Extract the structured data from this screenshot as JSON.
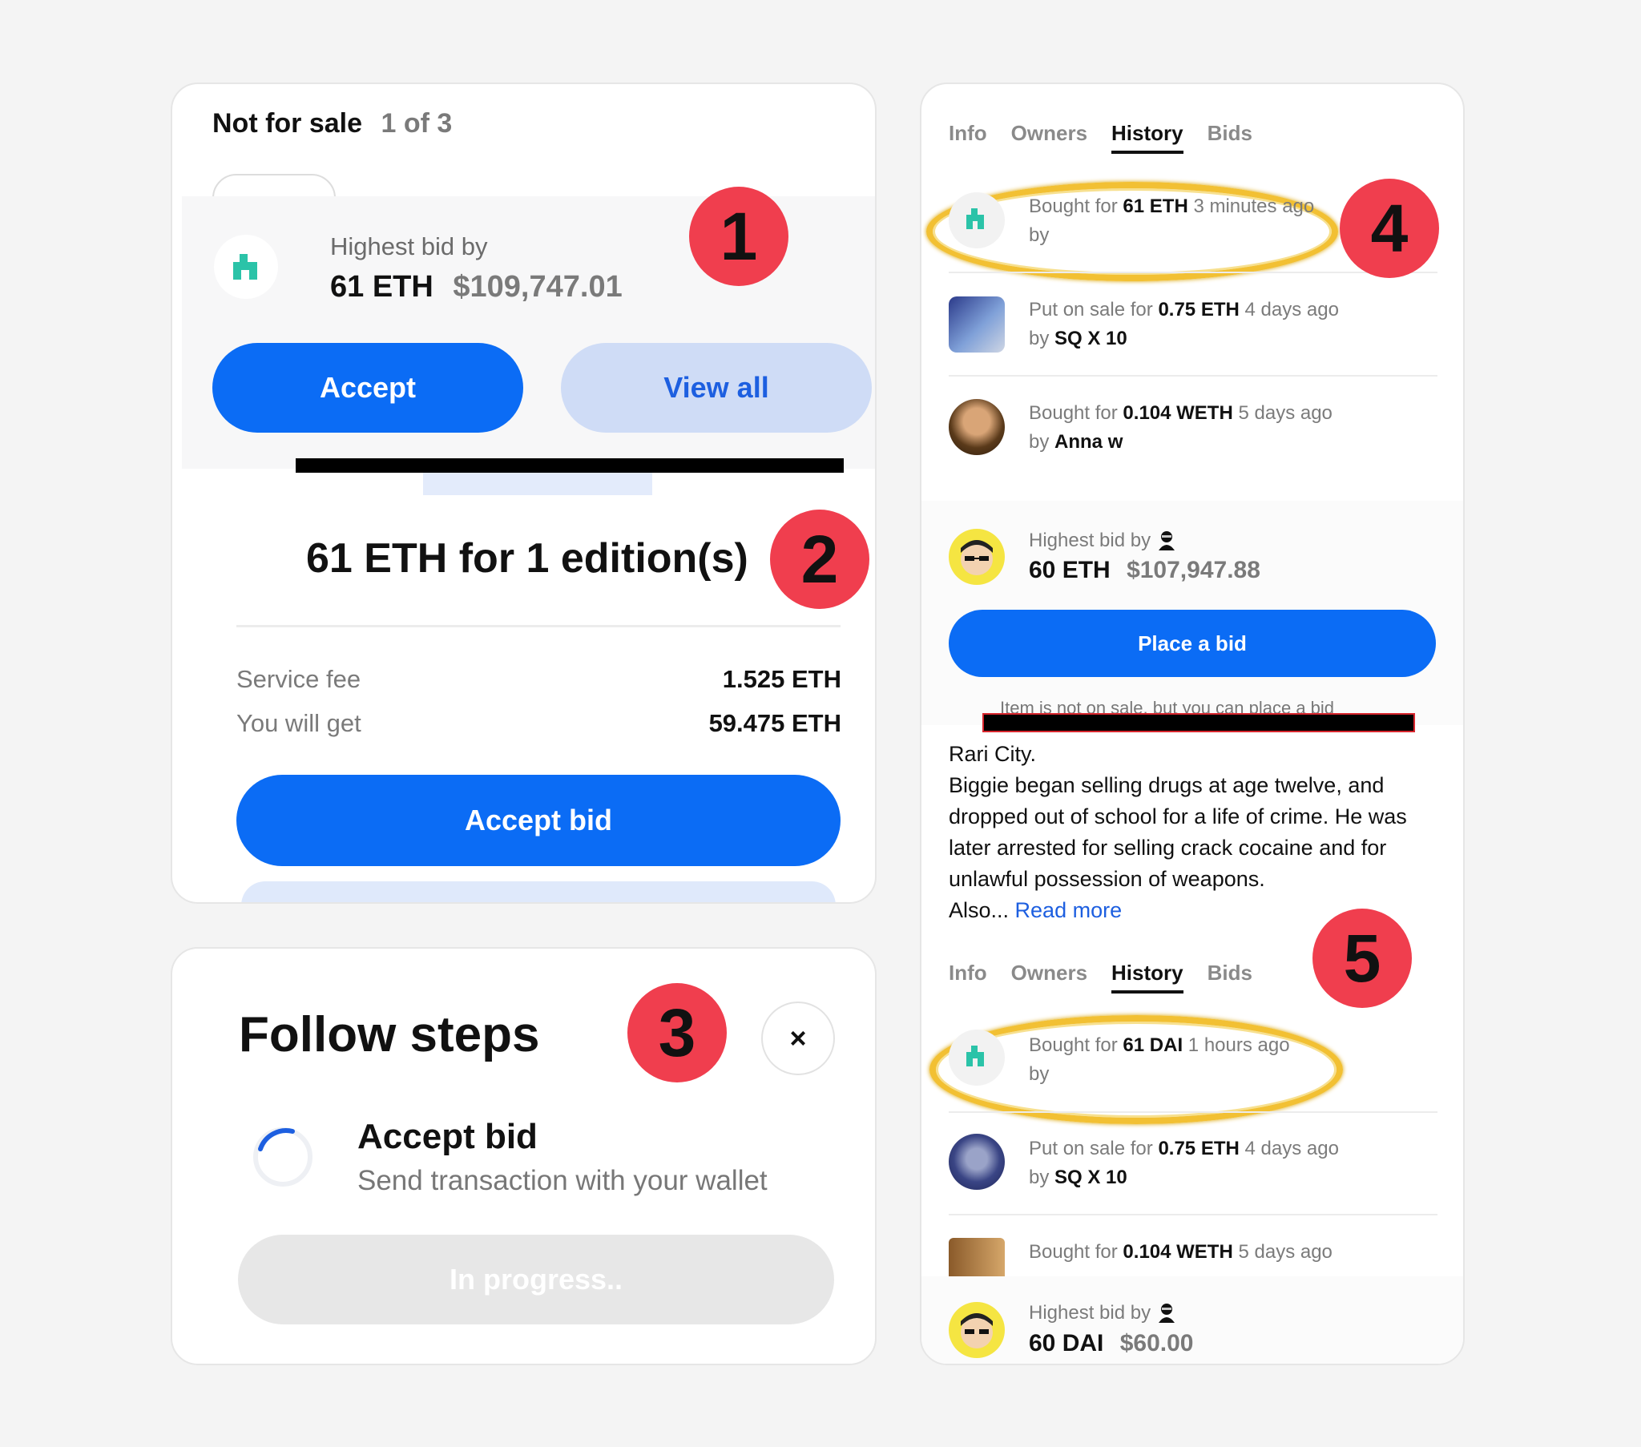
{
  "left_card": {
    "status": "Not for sale",
    "edition_count": "1 of 3",
    "highest_bid_label": "Highest bid by",
    "bid_eth": "61 ETH",
    "bid_usd": "$109,747.01",
    "accept_button": "Accept",
    "view_all_button": "View all",
    "summary": "61 ETH for 1 edition(s)",
    "fee_label": "Service fee",
    "fee_value": "1.525 ETH",
    "get_label": "You will get",
    "get_value": "59.475 ETH",
    "accept_bid_button": "Accept bid"
  },
  "steps_card": {
    "title": "Follow steps",
    "close_icon": "×",
    "step_title": "Accept bid",
    "step_desc": "Send transaction with your wallet",
    "progress_button": "In progress.."
  },
  "badges": [
    "1",
    "2",
    "3",
    "4",
    "5"
  ],
  "right_card": {
    "tabs": [
      "Info",
      "Owners",
      "History",
      "Bids"
    ],
    "history_top": [
      {
        "pre": "Bought for",
        "amount": "61 ETH",
        "time": "3 minutes ago",
        "by": "by",
        "user": ""
      },
      {
        "pre": "Put on sale for",
        "amount": "0.75 ETH",
        "time": "4 days ago",
        "by": "by",
        "user": "SQ X 10"
      },
      {
        "pre": "Bought for",
        "amount": "0.104 WETH",
        "time": "5 days ago",
        "by": "by",
        "user": "Anna w"
      }
    ],
    "bid_label": "Highest bid by",
    "bid_eth": "60 ETH",
    "bid_usd": "$107,947.88",
    "place_bid_button": "Place a bid",
    "notice": "Item is not on sale, but you can place a bid",
    "desc_line1": "Rari City.",
    "desc_body": "Biggie began selling drugs at age twelve, and dropped out of school for a life of crime. He was later arrested for selling crack cocaine and for unlawful possession of weapons.",
    "desc_also": "Also...",
    "read_more": "Read more",
    "history_bottom": [
      {
        "pre": "Bought for",
        "amount": "61 DAI",
        "time": "1 hours ago",
        "by": "by",
        "user": ""
      },
      {
        "pre": "Put on sale for",
        "amount": "0.75 ETH",
        "time": "4 days ago",
        "by": "by",
        "user": "SQ X 10"
      },
      {
        "pre": "Bought for",
        "amount": "0.104 WETH",
        "time": "5 days ago"
      }
    ],
    "bid2_label": "Highest bid by",
    "bid2_amount": "60 DAI",
    "bid2_usd": "$60.00"
  },
  "colors": {
    "primary": "#0b6cf5",
    "soft": "#cfdcf6",
    "badge": "#f03e4e",
    "highlight": "#f2c033"
  }
}
